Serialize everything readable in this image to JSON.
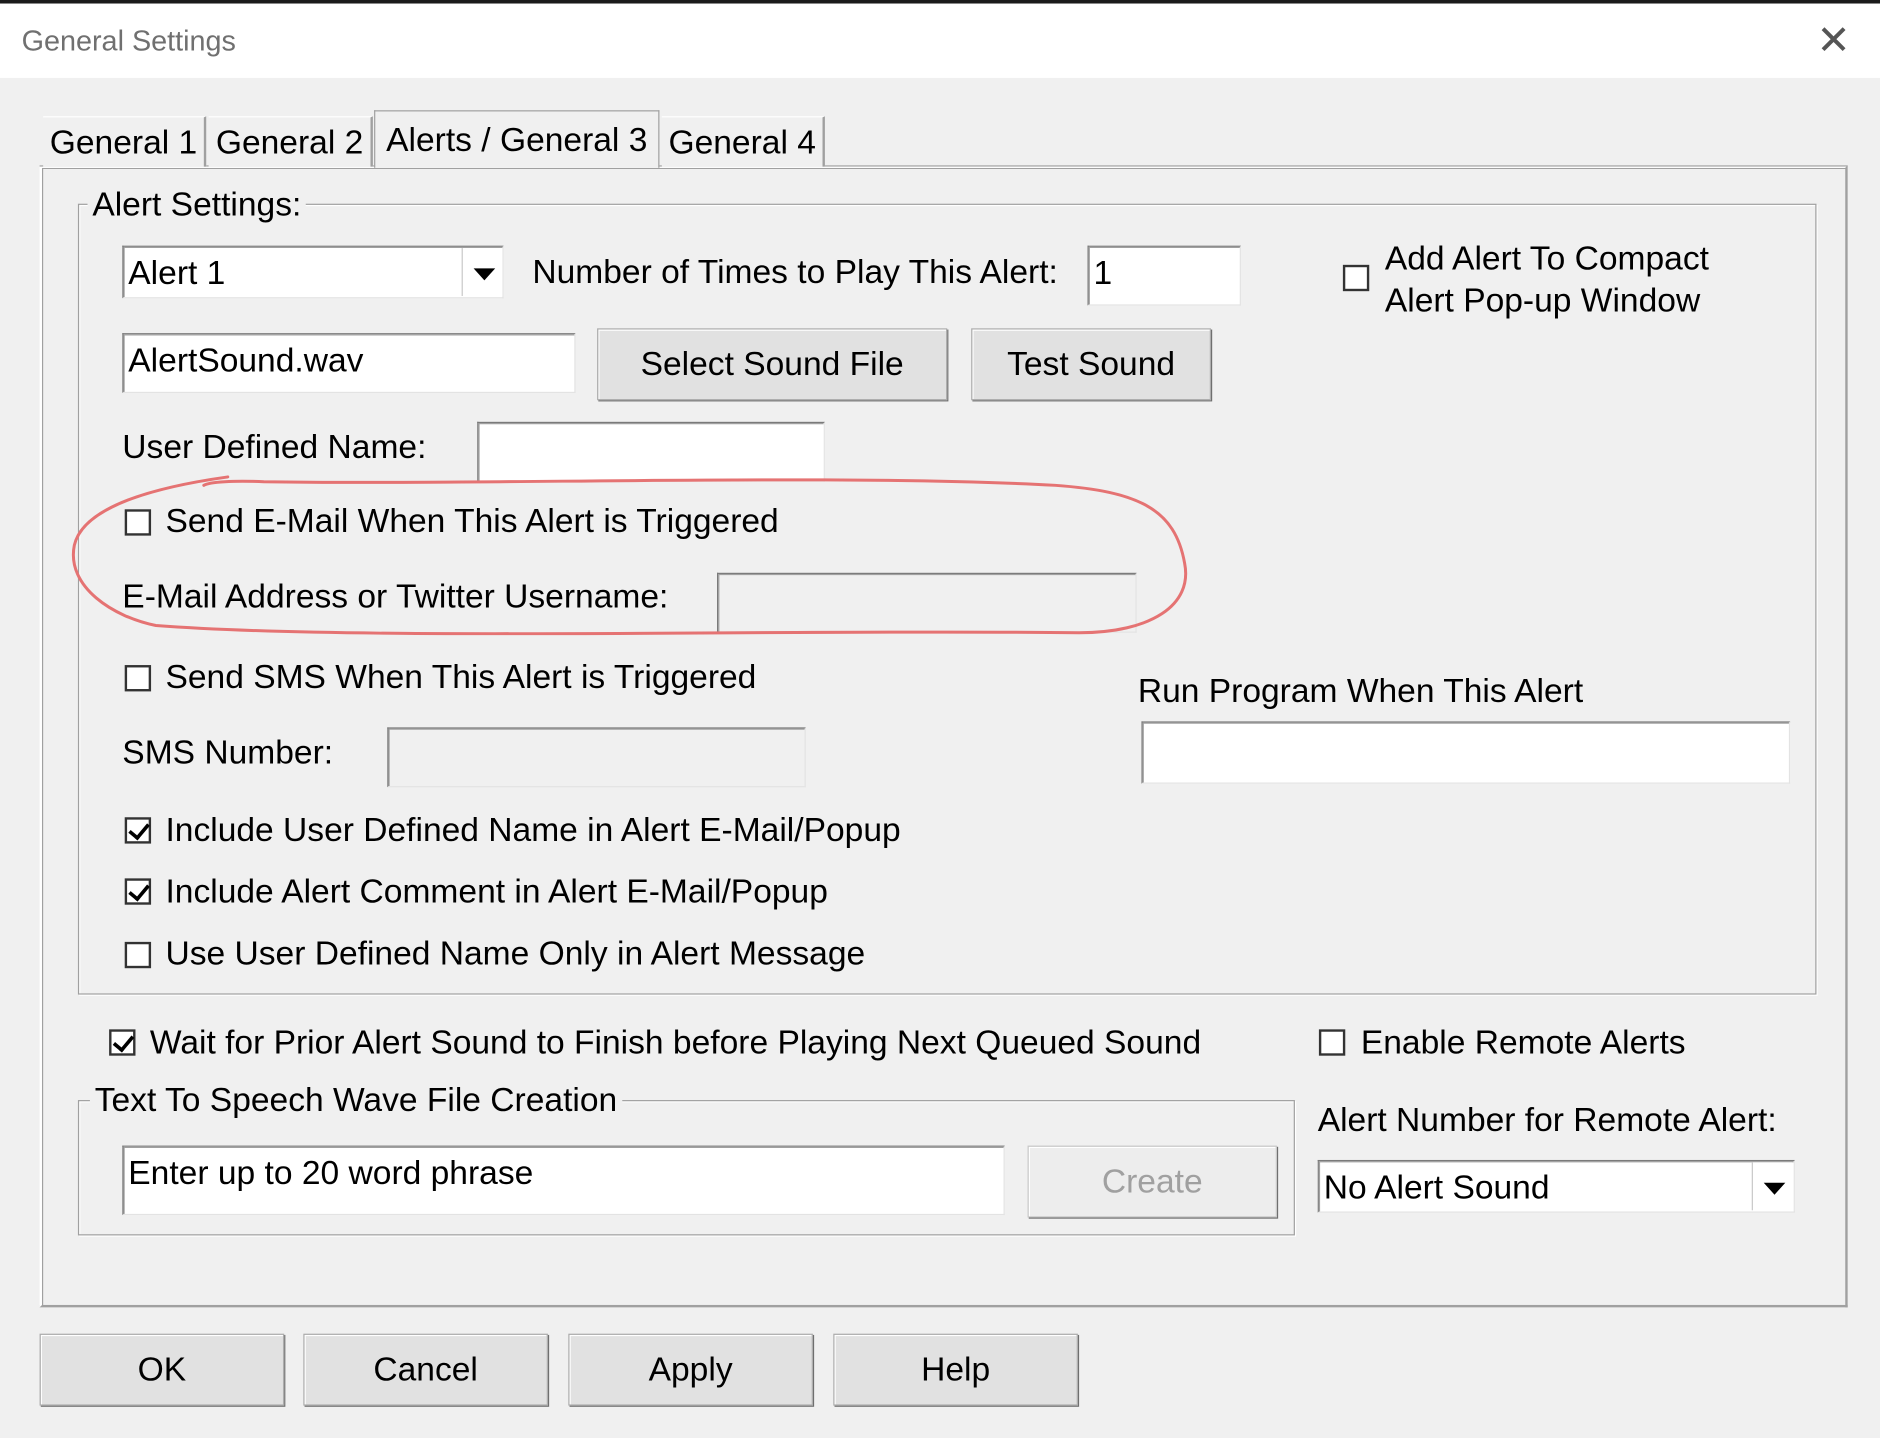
{
  "window": {
    "title": "General Settings",
    "close_label": "✕"
  },
  "tabs": [
    {
      "label": "General 1"
    },
    {
      "label": "General 2"
    },
    {
      "label": "Alerts / General 3"
    },
    {
      "label": "General 4"
    }
  ],
  "alert_settings": {
    "legend": "Alert Settings:",
    "alert_select": "Alert 1",
    "times_label": "Number of Times to Play This Alert:",
    "times_value": "1",
    "compact_label_line1": "Add Alert To Compact",
    "compact_label_line2": "Alert Pop-up Window",
    "sound_file": "AlertSound.wav",
    "select_sound_label": "Select Sound File",
    "test_sound_label": "Test Sound",
    "user_name_label": "User Defined Name:",
    "user_name_value": "",
    "email_check_label": "Send E-Mail When This Alert is Triggered",
    "email_label": "E-Mail Address or Twitter Username:",
    "email_value": "",
    "sms_check_label": "Send SMS When This Alert is Triggered",
    "sms_label": "SMS Number:",
    "sms_value": "",
    "run_program_label": "Run Program When This Alert",
    "run_program_value": "",
    "include_name_label": "Include User Defined Name in Alert E-Mail/Popup",
    "include_comment_label": "Include Alert Comment in Alert E-Mail/Popup",
    "use_name_only_label": "Use User Defined Name Only in Alert Message"
  },
  "wait_label": "Wait for Prior Alert Sound to Finish before Playing Next Queued Sound",
  "remote": {
    "enable_label": "Enable Remote Alerts",
    "number_label": "Alert Number for Remote Alert:",
    "number_value": "No Alert Sound"
  },
  "tts": {
    "legend": "Text To Speech Wave File Creation",
    "phrase_value": "Enter up to 20 word phrase",
    "create_label": "Create"
  },
  "footer": {
    "ok_label": "OK",
    "cancel_label": "Cancel",
    "apply_label": "Apply",
    "help_label": "Help"
  },
  "colors": {
    "annotation": "#e57373",
    "background": "#f0f0f0"
  }
}
